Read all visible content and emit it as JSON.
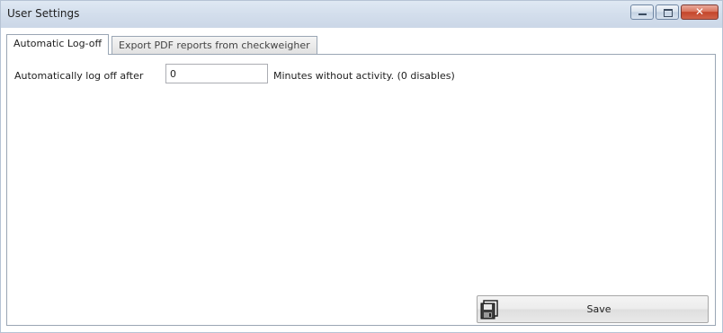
{
  "window": {
    "title": "User Settings",
    "minimize_icon": "minimize-icon",
    "maximize_icon": "maximize-icon",
    "close_icon": "close-icon",
    "close_glyph": "✕"
  },
  "tabs": [
    {
      "label": "Automatic Log-off",
      "active": true
    },
    {
      "label": "Export PDF reports from checkweigher",
      "active": false
    }
  ],
  "autologoff": {
    "label": "Automatically log off after",
    "minutes_value": "0",
    "suffix": "Minutes without activity. (0 disables)"
  },
  "footer": {
    "save_label": "Save",
    "save_icon": "floppy-disk-icon"
  },
  "colors": {
    "titlebar": "#d3deec",
    "close_button": "#c4452a",
    "border": "#9aa6b4"
  }
}
